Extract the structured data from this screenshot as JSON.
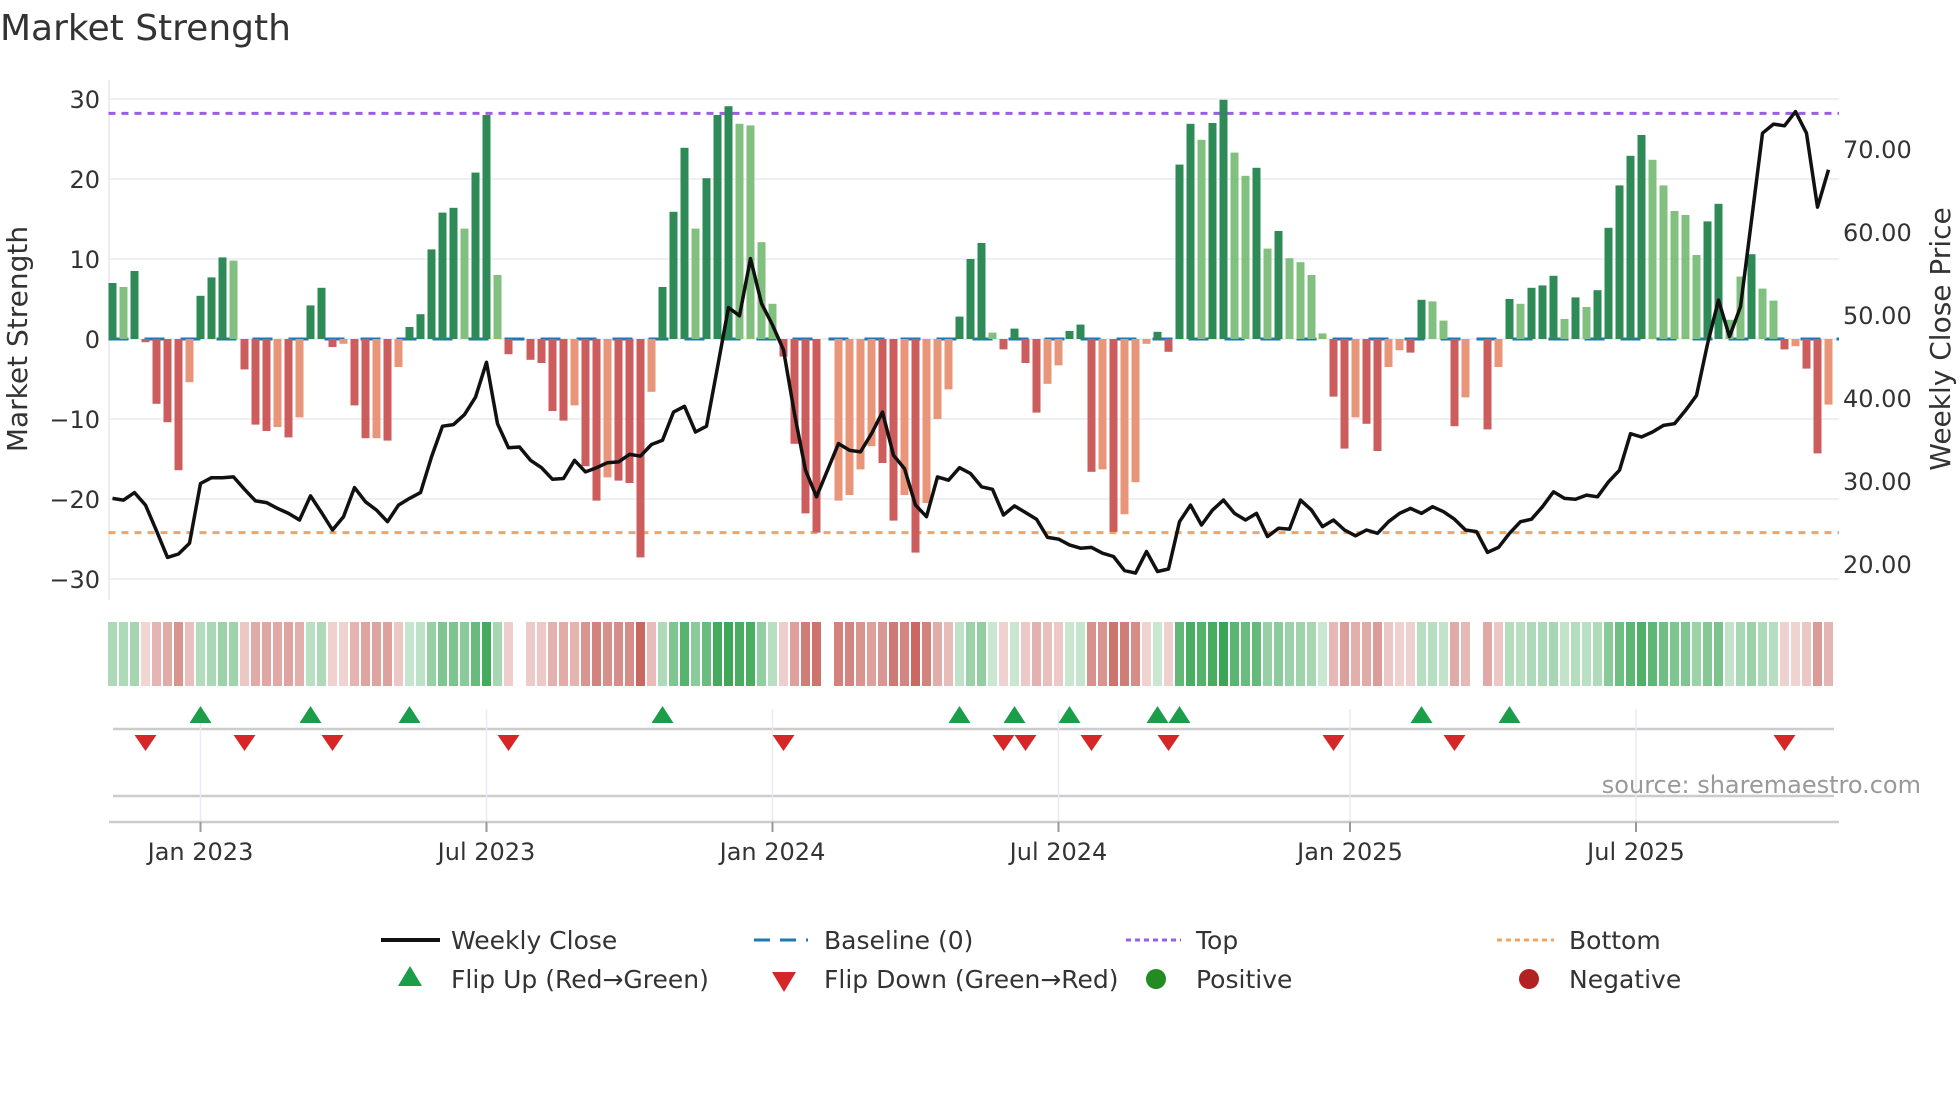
{
  "chart_data": {
    "type": "bar",
    "title": "Market Strength",
    "ylabel": "Market Strength",
    "y2label": "Weekly Close Price",
    "ylim": [
      -33,
      31
    ],
    "y2lim": [
      15.6,
      77.3
    ],
    "yticks": [
      "30",
      "20",
      "10",
      "0",
      "−10",
      "−20",
      "−30"
    ],
    "ytick_values": [
      30,
      20,
      10,
      0,
      -10,
      -20,
      -30
    ],
    "y2ticks": [
      "70.00",
      "60.00",
      "50.00",
      "40.00",
      "30.00",
      "20.00"
    ],
    "y2tick_values": [
      70,
      60,
      50,
      40,
      30,
      20
    ],
    "xticks": [
      "Jan 2023",
      "Jul 2023",
      "Jan 2024",
      "Jul 2024",
      "Jan 2025",
      "Jul 2025"
    ],
    "xtick_week_index": [
      8,
      34,
      60,
      86,
      112.5,
      138.5
    ],
    "top_level": 28.2,
    "bottom_level": -24.2,
    "baseline": 0,
    "colors": {
      "strong_positive": "#2e8b57",
      "weak_positive": "#82c07f",
      "strong_negative": "#cd5c5c",
      "weak_negative": "#e8957a",
      "baseline": "#1f77b4",
      "top": "#9b5de5",
      "bottom": "#f4a460",
      "flip_up": "#1a9e4a",
      "flip_down": "#d62728",
      "positive": "#228b22",
      "negative": "#b22222",
      "close": "#111111"
    },
    "strength": [
      7.0,
      6.5,
      8.5,
      -0.4,
      -8.1,
      -10.4,
      -16.4,
      -5.4,
      5.4,
      7.7,
      10.2,
      9.8,
      -3.8,
      -10.7,
      -11.5,
      -11.0,
      -12.3,
      -9.8,
      4.2,
      6.4,
      -1.0,
      -0.6,
      -8.3,
      -12.4,
      -12.4,
      -12.7,
      -3.5,
      1.5,
      3.1,
      11.2,
      15.8,
      16.4,
      13.8,
      20.8,
      28.0,
      8.0,
      -1.9,
      0,
      -2.6,
      -3.0,
      -9.0,
      -10.2,
      -8.3,
      -15.9,
      -20.2,
      -17.3,
      -17.7,
      -18.0,
      -27.3,
      -6.6,
      6.5,
      15.9,
      23.9,
      13.8,
      20.1,
      28.0,
      29.1,
      26.9,
      26.7,
      12.1,
      4.4,
      -2.2,
      -13.1,
      -21.8,
      -24.2,
      0,
      -20.2,
      -19.5,
      -16.3,
      -13.4,
      -15.5,
      -22.7,
      -19.5,
      -26.7,
      -20.5,
      -10.0,
      -6.3,
      2.8,
      10.0,
      12.0,
      0.8,
      -1.3,
      1.3,
      -3.0,
      -9.2,
      -5.6,
      -3.3,
      1.0,
      1.8,
      -16.6,
      -16.3,
      -24.1,
      -21.9,
      -17.9,
      -0.6,
      0.9,
      -1.6,
      21.8,
      26.9,
      24.9,
      27.0,
      29.9,
      23.3,
      20.4,
      21.4,
      11.3,
      13.5,
      10.1,
      9.6,
      8.0,
      0.7,
      -7.2,
      -13.7,
      -9.8,
      -10.6,
      -14.0,
      -3.5,
      -1.4,
      -1.7,
      4.9,
      4.7,
      2.3,
      -10.9,
      -7.3,
      0,
      -11.3,
      -3.5,
      5.0,
      4.4,
      6.4,
      6.7,
      7.9,
      2.5,
      5.2,
      4.0,
      6.1,
      13.9,
      19.2,
      22.9,
      25.5,
      22.4,
      19.2,
      16.0,
      15.5,
      10.5,
      14.7,
      16.9,
      2.4,
      7.8,
      10.6,
      6.3,
      4.8,
      -1.3,
      -0.9,
      -3.7,
      -14.3,
      -8.2
    ],
    "strengthening": [
      1,
      0,
      1,
      1,
      1,
      1,
      1,
      0,
      1,
      1,
      1,
      0,
      1,
      1,
      1,
      0,
      1,
      0,
      1,
      1,
      1,
      0,
      1,
      1,
      0,
      1,
      0,
      1,
      1,
      1,
      1,
      1,
      0,
      1,
      1,
      0,
      1,
      1,
      1,
      1,
      1,
      1,
      0,
      1,
      1,
      0,
      1,
      1,
      1,
      0,
      1,
      1,
      1,
      0,
      1,
      1,
      1,
      0,
      0,
      0,
      0,
      1,
      1,
      1,
      1,
      1,
      0,
      0,
      0,
      0,
      1,
      1,
      0,
      1,
      0,
      0,
      0,
      1,
      1,
      1,
      0,
      1,
      1,
      1,
      1,
      0,
      0,
      1,
      1,
      1,
      0,
      1,
      0,
      0,
      0,
      1,
      1,
      1,
      1,
      0,
      1,
      1,
      0,
      0,
      1,
      0,
      1,
      0,
      0,
      0,
      0,
      1,
      1,
      0,
      1,
      1,
      0,
      0,
      1,
      1,
      0,
      0,
      1,
      0,
      1,
      1,
      0,
      1,
      0,
      1,
      1,
      1,
      0,
      1,
      0,
      1,
      1,
      1,
      1,
      1,
      0,
      0,
      0,
      0,
      0,
      1,
      1,
      0,
      0,
      1,
      0,
      0,
      1,
      0,
      1,
      1,
      0
    ],
    "weekly_close": [
      27.9,
      27.7,
      28.6,
      27.1,
      24.0,
      20.8,
      21.2,
      22.5,
      29.7,
      30.4,
      30.4,
      30.5,
      29.0,
      27.6,
      27.4,
      26.7,
      26.1,
      25.3,
      28.2,
      26.2,
      24.1,
      25.7,
      29.2,
      27.5,
      26.5,
      25.1,
      27.1,
      27.9,
      28.6,
      32.9,
      36.6,
      36.8,
      38.0,
      40.1,
      44.3,
      36.9,
      34.0,
      34.1,
      32.5,
      31.6,
      30.2,
      30.3,
      32.5,
      31.1,
      31.6,
      32.2,
      32.3,
      33.2,
      33.0,
      34.4,
      34.9,
      38.3,
      39.0,
      35.9,
      36.6,
      43.7,
      50.9,
      49.9,
      56.8,
      51.4,
      48.8,
      45.8,
      38.1,
      31.3,
      28.1,
      31.3,
      34.5,
      33.7,
      33.5,
      35.7,
      38.3,
      33.1,
      31.5,
      27.1,
      25.7,
      30.5,
      30.1,
      31.6,
      30.9,
      29.3,
      29.0,
      25.9,
      27.0,
      26.2,
      25.4,
      23.2,
      23.0,
      22.3,
      21.9,
      22.0,
      21.3,
      20.9,
      19.2,
      18.9,
      21.5,
      19.1,
      19.4,
      25.1,
      27.1,
      24.7,
      26.5,
      27.7,
      26.1,
      25.3,
      26.1,
      23.3,
      24.3,
      24.2,
      27.7,
      26.5,
      24.5,
      25.3,
      24.1,
      23.4,
      24.1,
      23.7,
      25.1,
      26.1,
      26.7,
      26.1,
      26.9,
      26.3,
      25.4,
      24.1,
      23.9,
      21.4,
      22.0,
      23.7,
      25.1,
      25.4,
      26.9,
      28.7,
      27.9,
      27.8,
      28.3,
      28.1,
      29.9,
      31.3,
      35.7,
      35.3,
      35.9,
      36.7,
      36.9,
      38.5,
      40.3,
      46.5,
      51.8,
      47.4,
      51.0,
      61.4,
      71.9,
      73.0,
      72.8,
      74.5,
      71.9,
      63.0,
      67.5
    ],
    "flip_up_weeks": [
      9,
      19,
      28,
      51,
      78,
      83,
      88,
      96,
      98,
      120,
      128
    ],
    "flip_down_weeks": [
      4,
      13,
      21,
      37,
      62,
      82,
      84,
      90,
      97,
      112,
      123,
      153
    ],
    "legend": {
      "weekly_close": "Weekly Close",
      "baseline": "Baseline (0)",
      "top": "Top",
      "bottom": "Bottom",
      "flip_up": "Flip Up (Red→Green)",
      "flip_down": "Flip Down (Green→Red)",
      "positive": "Positive",
      "negative": "Negative"
    },
    "legend_placement": "bottom",
    "grid": true
  },
  "source": "source: sharemaestro.com"
}
